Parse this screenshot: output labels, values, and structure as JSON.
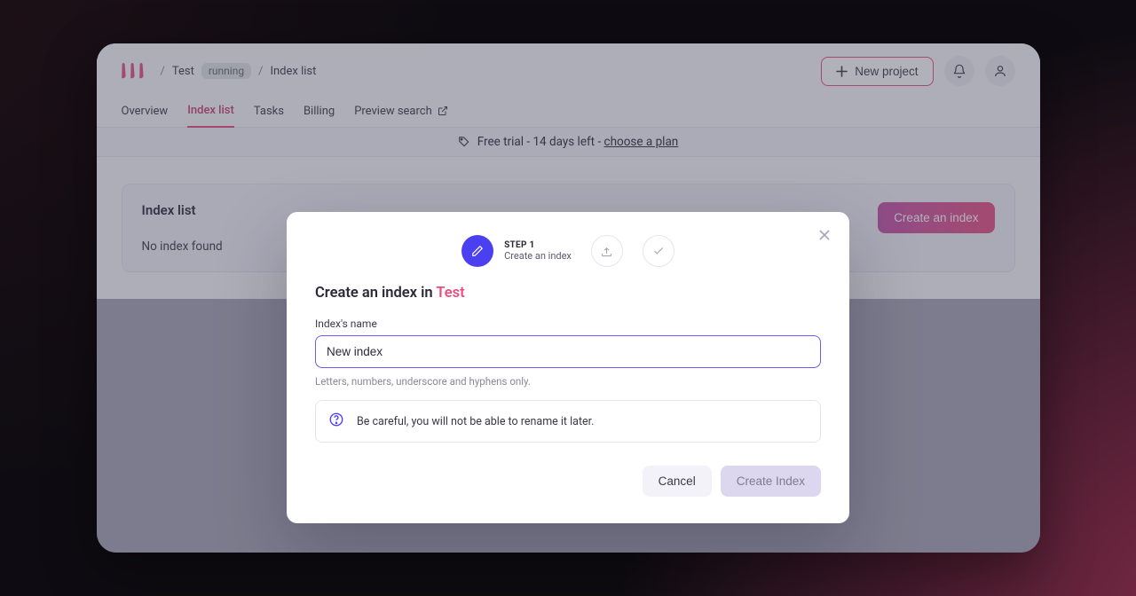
{
  "breadcrumbs": {
    "project": "Test",
    "status": "running",
    "page": "Index list"
  },
  "header": {
    "new_project_label": "New project"
  },
  "tabs": {
    "overview": "Overview",
    "index_list": "Index list",
    "tasks": "Tasks",
    "billing": "Billing",
    "preview": "Preview search"
  },
  "trial": {
    "prefix": "Free trial - ",
    "days": "14 days left",
    "sep": " - ",
    "cta": "choose a plan"
  },
  "panel": {
    "title": "Index list",
    "empty": "No index found",
    "create_btn": "Create an index"
  },
  "modal": {
    "step_label": "STEP 1",
    "step_sub": "Create an index",
    "title_pre": "Create an index in ",
    "title_proj": "Test",
    "field_label": "Index's name",
    "field_value": "New index",
    "field_hint": "Letters, numbers, underscore and hyphens only.",
    "warning": "Be careful, you will not be able to rename it later.",
    "cancel": "Cancel",
    "submit": "Create Index"
  }
}
